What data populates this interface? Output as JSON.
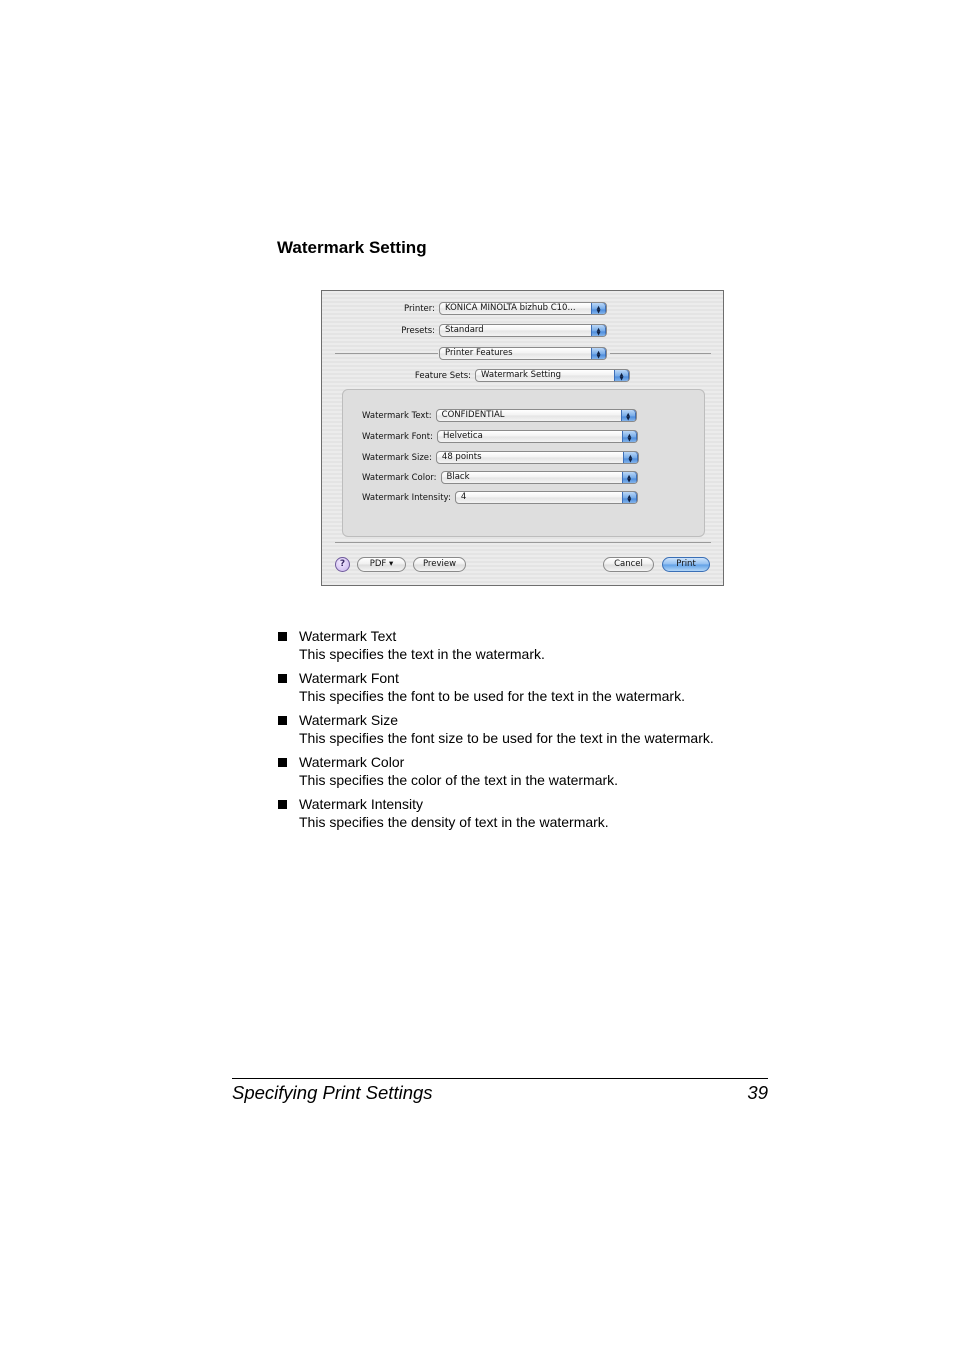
{
  "section_title": "Watermark Setting",
  "dialog": {
    "printer": {
      "label": "Printer:",
      "value": "KONICA MINOLTA bizhub C10..."
    },
    "presets": {
      "label": "Presets:",
      "value": "Standard"
    },
    "panel": {
      "value": "Printer Features"
    },
    "feature_sets": {
      "label": "Feature Sets:",
      "value": "Watermark Setting"
    },
    "fields": [
      {
        "label": "Watermark Text:",
        "value": "CONFIDENTIAL"
      },
      {
        "label": "Watermark Font:",
        "value": "Helvetica"
      },
      {
        "label": "Watermark Size:",
        "value": "48 points"
      },
      {
        "label": "Watermark Color:",
        "value": "Black"
      },
      {
        "label": "Watermark Intensity:",
        "value": "4"
      }
    ],
    "buttons": {
      "help": "?",
      "pdf": "PDF ▾",
      "preview": "Preview",
      "cancel": "Cancel",
      "print": "Print"
    },
    "popup_arrows": "▲▼"
  },
  "bullets": [
    {
      "title": "Watermark Text",
      "desc": "This specifies the text in the watermark."
    },
    {
      "title": "Watermark Font",
      "desc": "This specifies the font to be used for the text in the watermark."
    },
    {
      "title": "Watermark Size",
      "desc": "This specifies the font size to be used for the text in the watermark."
    },
    {
      "title": "Watermark Color",
      "desc": "This specifies the color of the text in the watermark."
    },
    {
      "title": "Watermark Intensity",
      "desc": "This specifies the density of text in the watermark."
    }
  ],
  "footer": {
    "title": "Specifying Print Settings",
    "page": "39"
  }
}
